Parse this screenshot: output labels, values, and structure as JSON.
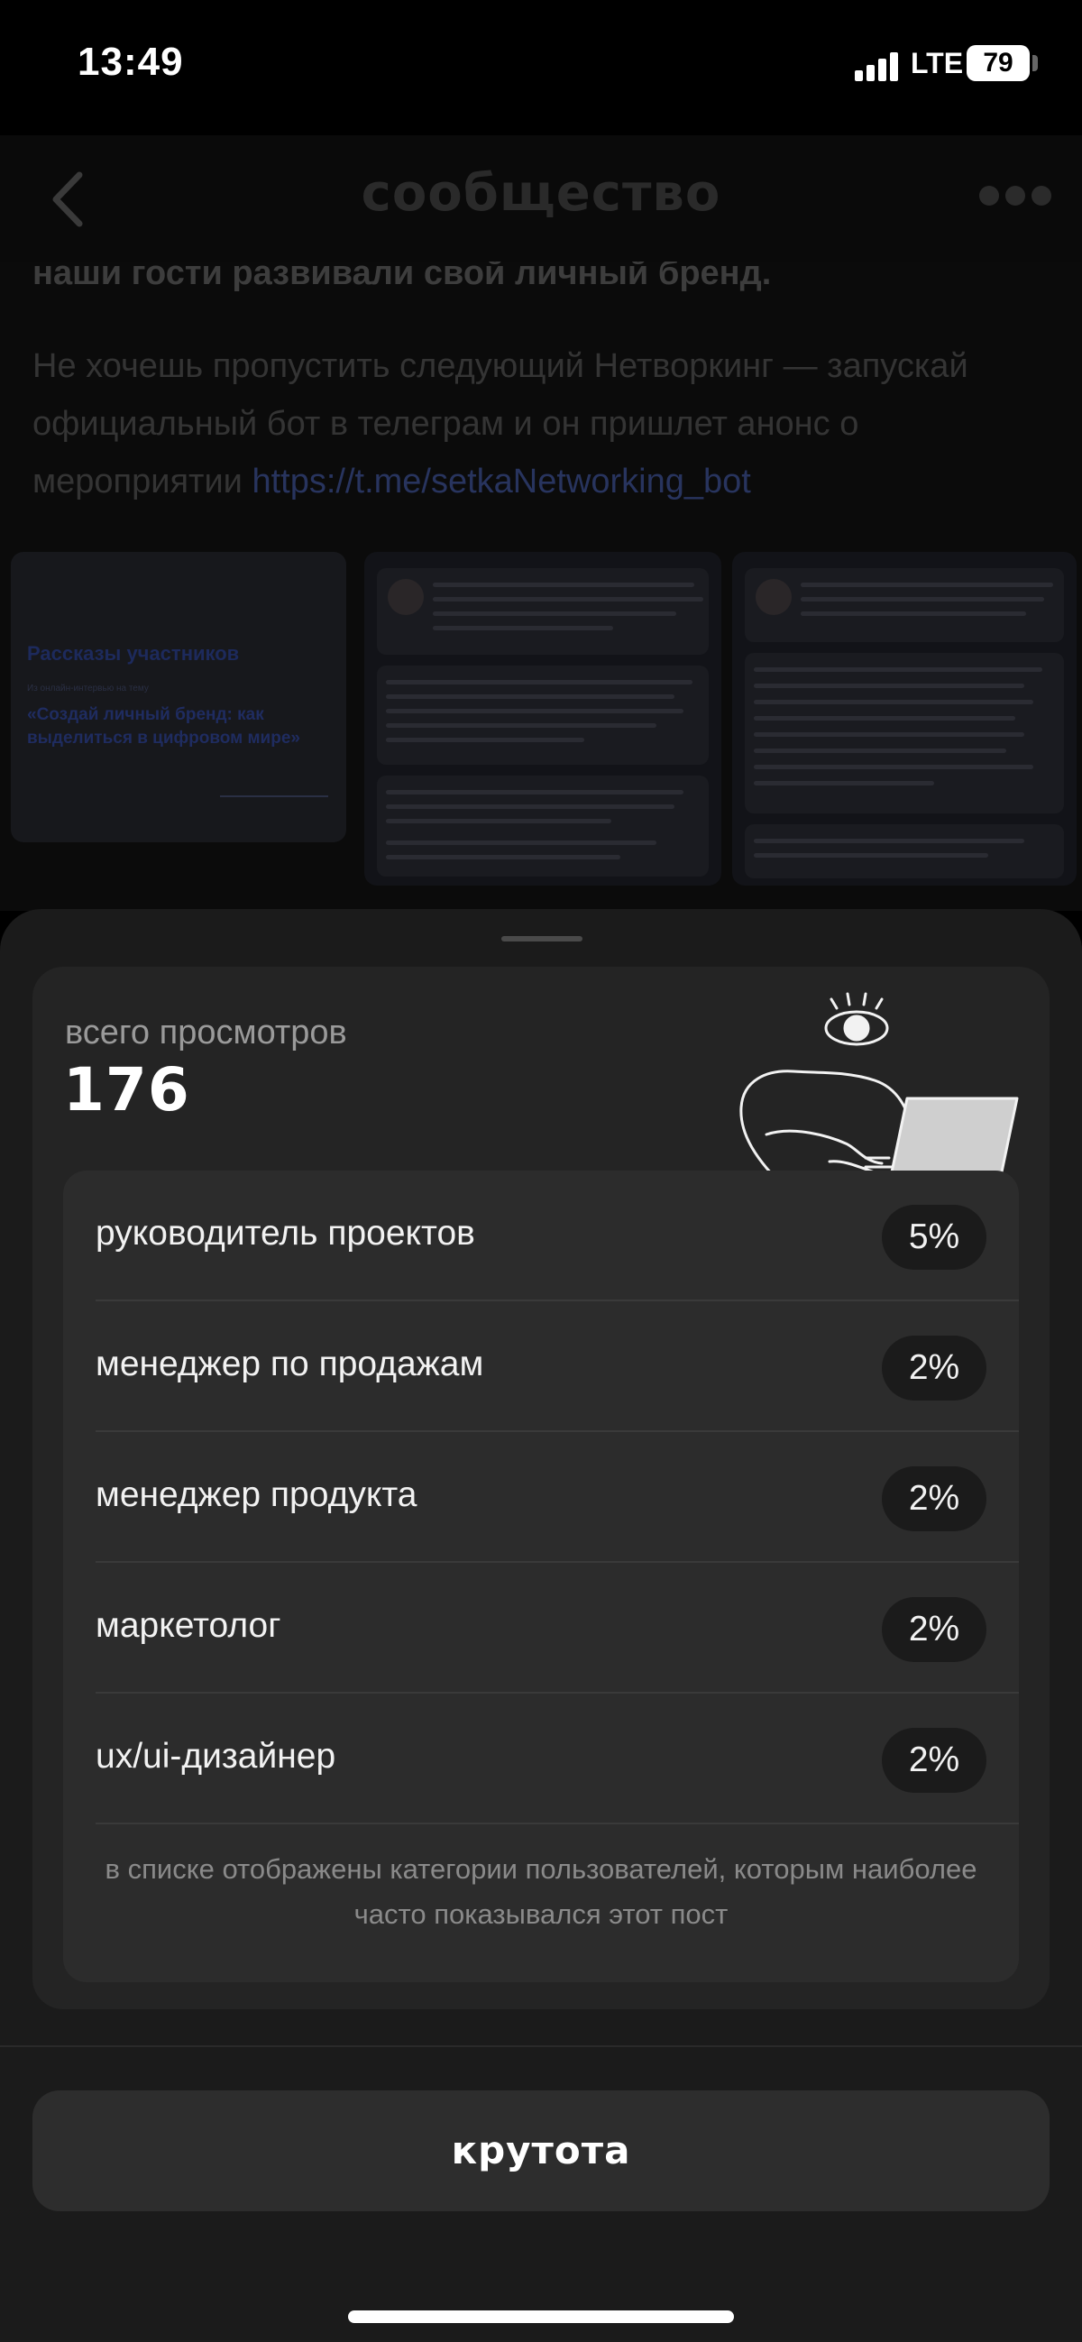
{
  "status_bar": {
    "time": "13:49",
    "network": "LTE",
    "battery": "79"
  },
  "header": {
    "title": "сообщество",
    "back_icon": "chevron-left-icon",
    "more_icon": "ellipsis-icon"
  },
  "post": {
    "bold_line": "наши гости развивали свой личный бренд.",
    "paragraph": "Не хочешь пропустить следующий Нетворкинг — запускай официальный бот в телеграм и он пришлет анонс о мероприятии ",
    "link": "https://t.me/setkaNetworking_bot",
    "slide_title": "Рассказы участников",
    "slide_small": "Из онлайн-интервью на тему",
    "slide_subtitle": "«Создай личный бренд: как выделиться в цифровом мире»"
  },
  "stats": {
    "views_label": "всего просмотров",
    "views_count": "176",
    "illustration_icon": "person-laptop-icon",
    "roles": [
      {
        "label": "руководитель проектов",
        "value": "5%"
      },
      {
        "label": "менеджер по продажам",
        "value": "2%"
      },
      {
        "label": "менеджер продукта",
        "value": "2%"
      },
      {
        "label": "маркетолог",
        "value": "2%"
      },
      {
        "label": "ux/ui-дизайнер",
        "value": "2%"
      }
    ],
    "note": "в списке отображены категории пользователей, которым наиболее часто показывался этот пост"
  },
  "cta": {
    "label": "крутота"
  }
}
